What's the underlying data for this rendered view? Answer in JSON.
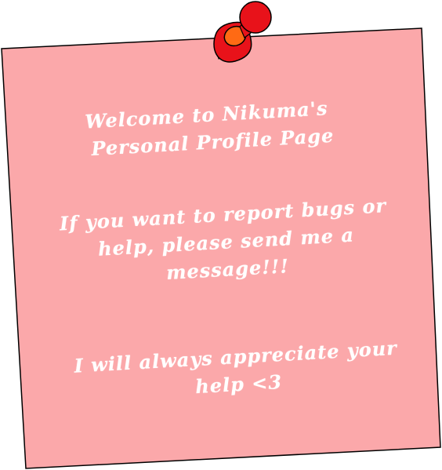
{
  "note": {
    "welcome_line_1": "Welcome to Nikuma's",
    "welcome_line_2": "Personal Profile Page",
    "report_line_1": "If you want to report bugs or",
    "report_line_2": "help, please send me a",
    "report_line_3": "message!!!",
    "thanks_line_1": "I will always appreciate your",
    "thanks_line_2": "help <3"
  },
  "colors": {
    "note_fill": "#fba8aa",
    "note_border": "#000000",
    "pin_red": "#e8121a",
    "pin_orange": "#ff6a14",
    "text": "#ffffff"
  },
  "icons": {
    "pin": "push-pin-icon"
  }
}
